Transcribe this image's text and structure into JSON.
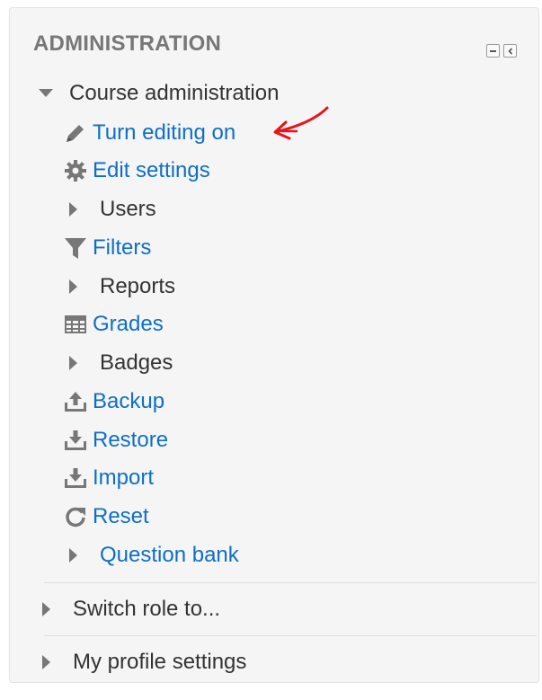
{
  "block": {
    "title": "ADMINISTRATION",
    "controls": {
      "hide_icon": "minus-box-icon",
      "dock_icon": "dock-left-icon"
    }
  },
  "course_admin": {
    "label": "Course administration",
    "items": [
      {
        "label": "Turn editing on",
        "icon": "pencil-icon"
      },
      {
        "label": "Edit settings",
        "icon": "gear-icon"
      },
      {
        "label": "Users",
        "icon": "caret-right-icon"
      },
      {
        "label": "Filters",
        "icon": "filter-icon"
      },
      {
        "label": "Reports",
        "icon": "caret-right-icon"
      },
      {
        "label": "Grades",
        "icon": "table-icon"
      },
      {
        "label": "Badges",
        "icon": "caret-right-icon"
      },
      {
        "label": "Backup",
        "icon": "upload-icon"
      },
      {
        "label": "Restore",
        "icon": "download-icon"
      },
      {
        "label": "Import",
        "icon": "download-icon"
      },
      {
        "label": "Reset",
        "icon": "refresh-icon"
      },
      {
        "label": "Question bank",
        "icon": "caret-right-icon"
      }
    ]
  },
  "switch_role": {
    "label": "Switch role to..."
  },
  "profile_settings": {
    "label": "My profile settings"
  },
  "colors": {
    "link": "#0f6fc5",
    "text": "#333333",
    "title": "#777777",
    "annotation": "#e8141b"
  }
}
